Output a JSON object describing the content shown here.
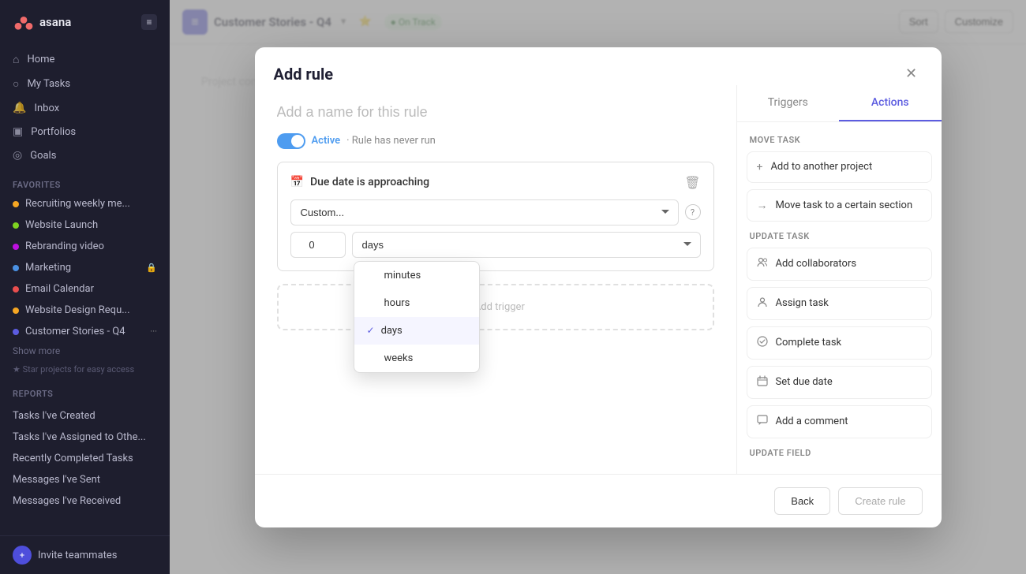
{
  "sidebar": {
    "logo_text": "asana",
    "nav_items": [
      {
        "label": "Home",
        "icon": "⌂"
      },
      {
        "label": "My Tasks",
        "icon": "○"
      },
      {
        "label": "Inbox",
        "icon": "🔔"
      },
      {
        "label": "Portfolios",
        "icon": "□"
      },
      {
        "label": "Goals",
        "icon": "◎"
      }
    ],
    "favorites_label": "Favorites",
    "projects": [
      {
        "label": "Recruiting weekly me...",
        "color": "#f5a623"
      },
      {
        "label": "Website Launch",
        "color": "#7ed321"
      },
      {
        "label": "Rebranding video",
        "color": "#bd10e0"
      },
      {
        "label": "Marketing",
        "color": "#4a90e2"
      },
      {
        "label": "Email Calendar",
        "color": "#e94e4e"
      },
      {
        "label": "Website Design Requ...",
        "color": "#f5a623"
      },
      {
        "label": "Customer Stories - Q4",
        "color": "#5c5ce0"
      }
    ],
    "show_more": "Show more",
    "star_hint": "★ Star projects for easy access",
    "reports_label": "Reports",
    "report_items": [
      "Tasks I've Created",
      "Tasks I've Assigned to Othe...",
      "Recently Completed Tasks",
      "Messages I've Sent",
      "Messages I've Received"
    ],
    "invite_label": "Invite teammates"
  },
  "main_header": {
    "project_title": "Customer Stories - Q4",
    "status": "On Track",
    "sort_label": "Sort",
    "customize_label": "Customize"
  },
  "modal": {
    "title": "Add rule",
    "rule_name_placeholder": "Add a name for this rule",
    "active_label": "Active",
    "never_run_label": "· Rule has never run",
    "trigger": {
      "title": "Due date is approaching",
      "custom_option": "Custom...",
      "value": "0",
      "unit": "days"
    },
    "dropdown_options": [
      {
        "label": "minutes",
        "selected": false
      },
      {
        "label": "hours",
        "selected": false
      },
      {
        "label": "days",
        "selected": true
      },
      {
        "label": "weeks",
        "selected": false
      }
    ],
    "add_trigger_placeholder": "+ Add trigger",
    "tabs": {
      "triggers_label": "Triggers",
      "actions_label": "Actions"
    },
    "panel": {
      "move_task_label": "Move task",
      "update_task_label": "Update task",
      "update_field_label": "Update field",
      "actions": [
        {
          "icon": "+",
          "label": "Add to another project",
          "section": "move_task"
        },
        {
          "icon": "→",
          "label": "Move task to a certain section",
          "section": "move_task"
        },
        {
          "icon": "👤",
          "label": "Add collaborators",
          "section": "update_task"
        },
        {
          "icon": "👤",
          "label": "Assign task",
          "section": "update_task"
        },
        {
          "icon": "○",
          "label": "Complete task",
          "section": "update_task"
        },
        {
          "icon": "📅",
          "label": "Set due date",
          "section": "update_task"
        },
        {
          "icon": "💬",
          "label": "Add a comment",
          "section": "update_task"
        }
      ]
    },
    "footer": {
      "back_label": "Back",
      "create_label": "Create rule"
    }
  }
}
